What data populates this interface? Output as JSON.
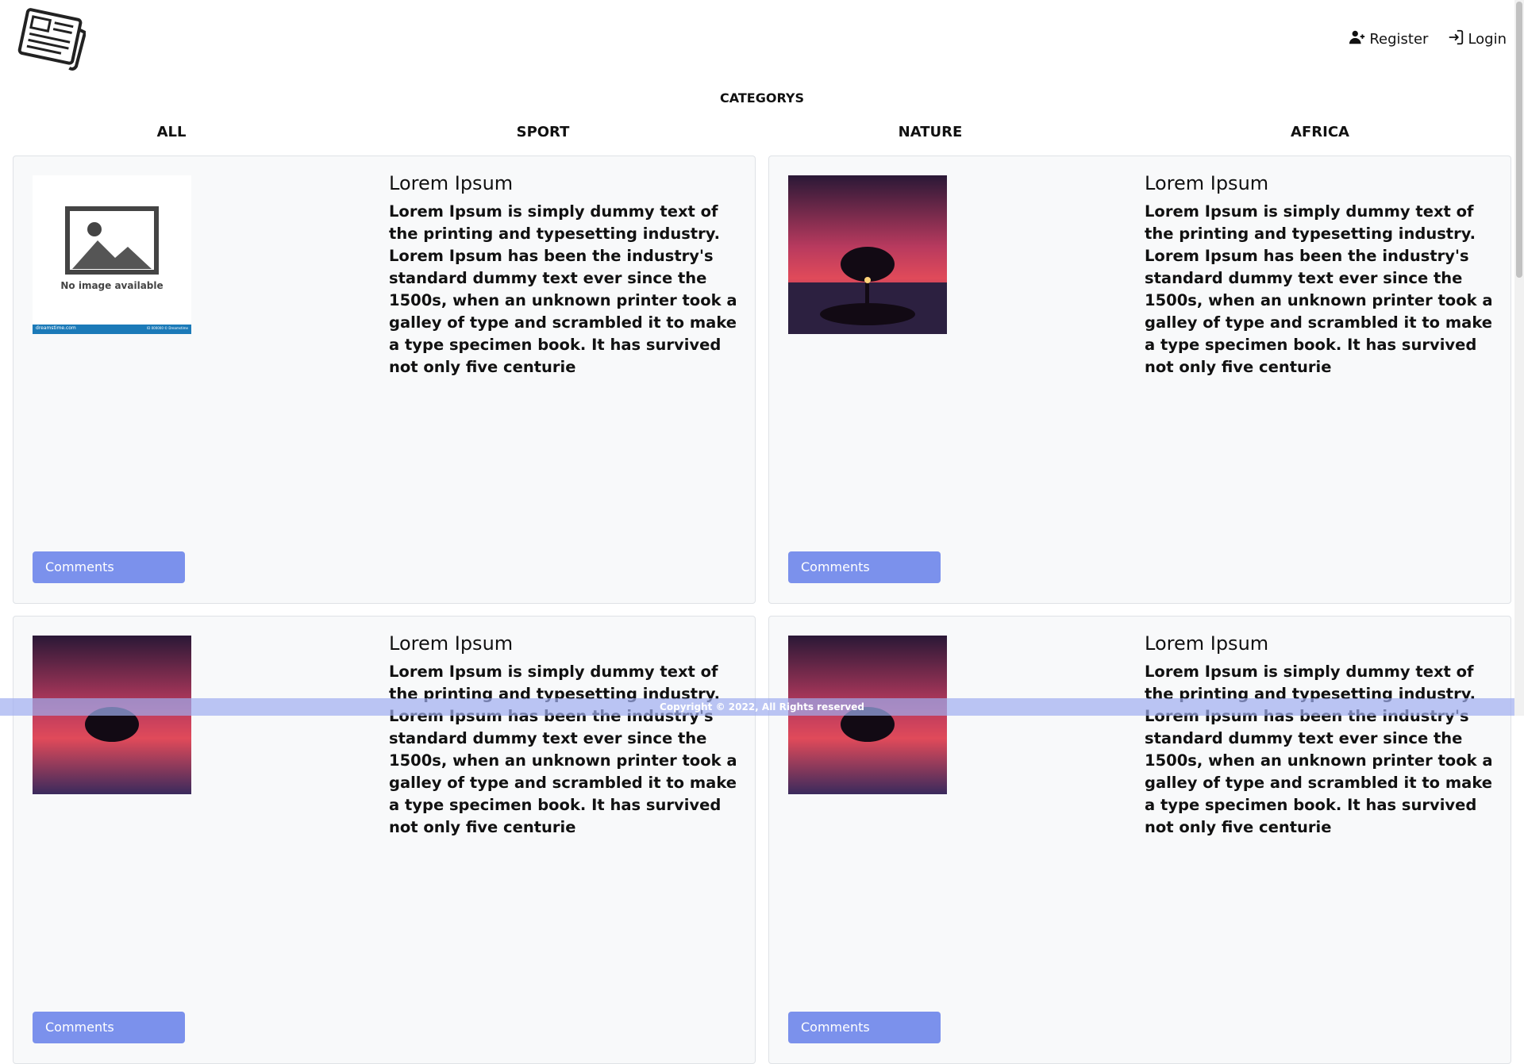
{
  "header": {
    "logo_icon": "newspaper-icon",
    "register_label": "Register",
    "register_icon": "user-plus-icon",
    "login_label": "Login",
    "login_icon": "sign-in-icon"
  },
  "categories": {
    "title": "CATEGORYS",
    "items": [
      "ALL",
      "SPORT",
      "NATURE",
      "AFRICA"
    ]
  },
  "posts": [
    {
      "title": "Lorem Ipsum",
      "body": "Lorem Ipsum is simply dummy text of the printing and typesetting industry. Lorem Ipsum has been the industry's standard dummy text ever since the 1500s, when an unknown printer took a galley of type and scrambled it to make a type specimen book. It has survived not only five centurie",
      "image": {
        "type": "placeholder",
        "caption": "No image available",
        "footer_left": "dreamstime.com",
        "footer_right": "ID 000000 © Dreamstime"
      },
      "button_label": "Comments"
    },
    {
      "title": "Lorem Ipsum",
      "body": "Lorem Ipsum is simply dummy text of the printing and typesetting industry. Lorem Ipsum has been the industry's standard dummy text ever since the 1500s, when an unknown printer took a galley of type and scrambled it to make a type specimen book. It has survived not only five centurie",
      "image": {
        "type": "tree-sunset"
      },
      "button_label": "Comments"
    },
    {
      "title": "Lorem Ipsum",
      "body": "Lorem Ipsum is simply dummy text of the printing and typesetting industry. Lorem Ipsum has been the industry's standard dummy text ever since the 1500s, when an unknown printer took a galley of type and scrambled it to make a type specimen book. It has survived not only five centurie",
      "image": {
        "type": "tree-sunset"
      },
      "button_label": "Comments"
    },
    {
      "title": "Lorem Ipsum",
      "body": "Lorem Ipsum is simply dummy text of the printing and typesetting industry. Lorem Ipsum has been the industry's standard dummy text ever since the 1500s, when an unknown printer took a galley of type and scrambled it to make a type specimen book. It has survived not only five centurie",
      "image": {
        "type": "tree-sunset"
      },
      "button_label": "Comments"
    }
  ],
  "footer": {
    "text": "Copyright © 2022, All Rights reserved"
  },
  "colors": {
    "button": "#7b91ec",
    "card_bg": "#f8f9fa",
    "footer_bg": "#a0aef0"
  }
}
